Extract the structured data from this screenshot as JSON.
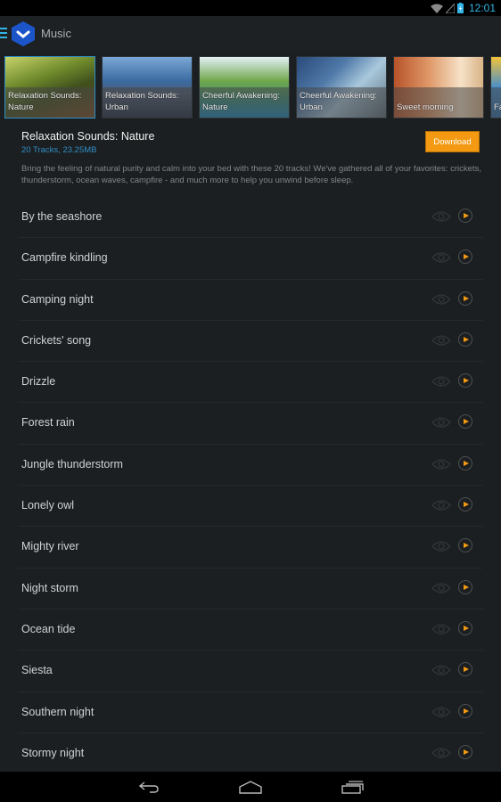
{
  "status_bar": {
    "time": "12:01",
    "icons": [
      "wifi-icon",
      "signal-icon",
      "battery-charging-icon"
    ]
  },
  "action_bar": {
    "title": "Music",
    "icons": [
      "menu-icon",
      "app-logo-icon"
    ]
  },
  "carousel": {
    "tiles": [
      {
        "label": "Relaxation Sounds: Nature",
        "selected": true
      },
      {
        "label": "Relaxation Sounds: Urban",
        "selected": false
      },
      {
        "label": "Cheerful Awakening: Nature",
        "selected": false
      },
      {
        "label": "Cheerful Awakening: Urban",
        "selected": false
      },
      {
        "label": "Sweet morning",
        "selected": false
      },
      {
        "label": "Fa",
        "selected": false
      }
    ]
  },
  "detail": {
    "title": "Relaxation Sounds: Nature",
    "meta": "20 Tracks, 23.25MB",
    "description": "Bring the feeling of natural purity and calm into your bed with these 20 tracks! We've gathered all of your favorites: crickets, thunderstorm, ocean waves, campfire - and much more to help you unwind before sleep.",
    "download_label": "Download"
  },
  "tracks": [
    {
      "name": "By the seashore"
    },
    {
      "name": "Campfire kindling"
    },
    {
      "name": "Camping night"
    },
    {
      "name": "Crickets' song"
    },
    {
      "name": "Drizzle"
    },
    {
      "name": "Forest rain"
    },
    {
      "name": "Jungle thunderstorm"
    },
    {
      "name": "Lonely owl"
    },
    {
      "name": "Mighty river"
    },
    {
      "name": "Night storm"
    },
    {
      "name": "Ocean tide"
    },
    {
      "name": "Siesta"
    },
    {
      "name": "Southern night"
    },
    {
      "name": "Stormy night"
    }
  ],
  "nav_bar": {
    "buttons": [
      "back-icon",
      "home-icon",
      "recents-icon"
    ]
  },
  "colors": {
    "accent": "#33b5e5",
    "link": "#2f8fc7",
    "download": "#f39a12",
    "play": "#f39a12"
  }
}
